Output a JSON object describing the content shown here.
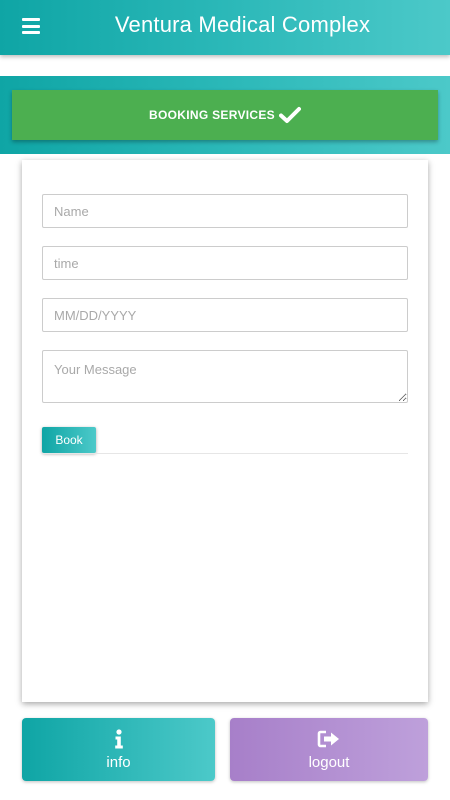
{
  "header": {
    "title": "Ventura Medical Complex",
    "menu_icon": "hamburger-menu-icon"
  },
  "booking_banner": {
    "label": "BOOKING SERVICES",
    "icon": "checkmark-icon",
    "color": "#4caf50"
  },
  "form": {
    "name_placeholder": "Name",
    "time_placeholder": "time",
    "date_placeholder": "MM/DD/YYYY",
    "message_placeholder": "Your Message",
    "submit_label": "Book"
  },
  "footer": {
    "info_label": "info",
    "info_icon": "info-icon",
    "logout_label": "logout",
    "logout_icon": "sign-out-icon"
  },
  "colors": {
    "accent": "#1fb0b0",
    "success": "#4caf50",
    "logout": "#b390d4"
  }
}
